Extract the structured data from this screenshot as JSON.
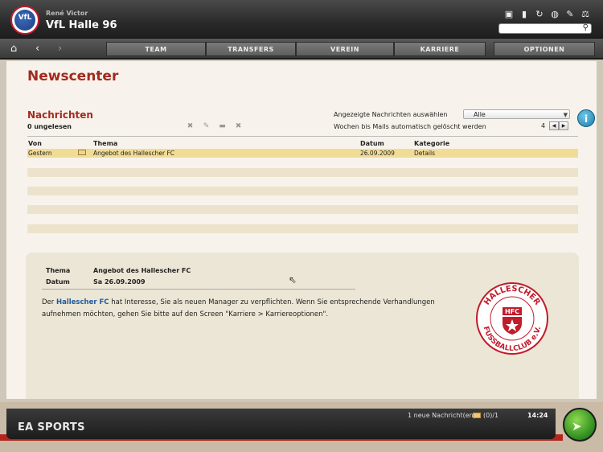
{
  "header": {
    "manager_name": "René Victor",
    "club_name": "VfL Halle 96",
    "club_logo_text": "VfL",
    "search": {
      "value": "",
      "placeholder": ""
    }
  },
  "nav": {
    "tabs": [
      {
        "label": "TEAM"
      },
      {
        "label": "TRANSFERS"
      },
      {
        "label": "VEREIN"
      },
      {
        "label": "KARRIERE"
      },
      {
        "label": "OPTIONEN"
      }
    ]
  },
  "page": {
    "title": "Newscenter",
    "section_title": "Nachrichten",
    "unread": "0 ungelesen",
    "filter_label": "Angezeigte Nachrichten auswählen",
    "filter_value": "Alle",
    "auto_delete_label": "Wochen bis Mails automatisch gelöscht werden",
    "auto_delete_value": "4"
  },
  "table": {
    "columns": [
      "Von",
      "Thema",
      "Datum",
      "Kategorie"
    ],
    "rows": [
      {
        "from": "Gestern",
        "subject": "Angebot des Hallescher FC",
        "date": "26.09.2009",
        "category": "Details"
      }
    ]
  },
  "detail": {
    "subject_label": "Thema",
    "subject_value": "Angebot des Hallescher FC",
    "date_label": "Datum",
    "date_value": "Sa 26.09.2009",
    "body_link": "Hallescher FC",
    "body_part1": " hat Interesse, Sie als neuen Manager zu verpflichten. Wenn Sie entsprechende Verhandlungen aufnehmen möchten, gehen Sie bitte auf den Screen \"Karriere > Karriereoptionen\".",
    "body_prefix": "Der ",
    "logo_text": "HALLESCHER FUSSBALLCLUB e.V.",
    "logo_center": "HFC"
  },
  "footer": {
    "brand": "EA SPORTS",
    "new_messages": "1 neue Nachricht(en)",
    "mail_count": "(0)/1",
    "clock": "14:24"
  },
  "colors": {
    "title_red": "#a32a1f",
    "highlight_row": "#f1dc95",
    "link_blue": "#1f5aa0"
  }
}
